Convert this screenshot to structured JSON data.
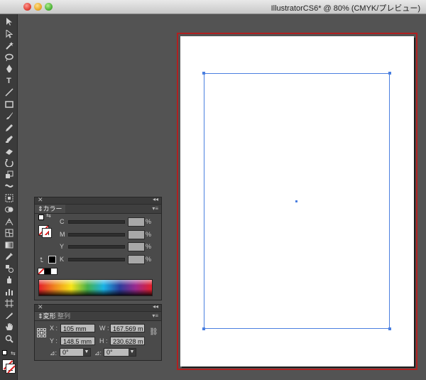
{
  "window": {
    "title": "IllustratorCS6* @ 80% (CMYK/プレビュー)"
  },
  "colors": {
    "accent_selection": "#4a7fe0",
    "artboard_border": "#b02020",
    "canvas_bg": "#535353"
  },
  "toolbar": {
    "tools": [
      {
        "name": "selection-tool-icon"
      },
      {
        "name": "direct-selection-tool-icon"
      },
      {
        "name": "magic-wand-tool-icon"
      },
      {
        "name": "lasso-tool-icon"
      },
      {
        "name": "pen-tool-icon"
      },
      {
        "name": "type-tool-icon",
        "glyph": "T"
      },
      {
        "name": "line-tool-icon"
      },
      {
        "name": "rectangle-tool-icon"
      },
      {
        "name": "paintbrush-tool-icon"
      },
      {
        "name": "pencil-tool-icon"
      },
      {
        "name": "blob-brush-tool-icon"
      },
      {
        "name": "eraser-tool-icon"
      },
      {
        "name": "rotate-tool-icon"
      },
      {
        "name": "scale-tool-icon"
      },
      {
        "name": "warp-tool-icon"
      },
      {
        "name": "free-transform-tool-icon"
      },
      {
        "name": "shape-builder-tool-icon"
      },
      {
        "name": "perspective-grid-tool-icon"
      },
      {
        "name": "mesh-tool-icon"
      },
      {
        "name": "gradient-tool-icon"
      },
      {
        "name": "eyedropper-tool-icon"
      },
      {
        "name": "blend-tool-icon"
      },
      {
        "name": "symbol-sprayer-tool-icon"
      },
      {
        "name": "column-graph-tool-icon"
      },
      {
        "name": "artboard-tool-icon"
      },
      {
        "name": "slice-tool-icon"
      },
      {
        "name": "hand-tool-icon"
      },
      {
        "name": "zoom-tool-icon"
      }
    ]
  },
  "color_panel": {
    "tab_label": "カラー",
    "channels": [
      {
        "label": "C",
        "unit": "%"
      },
      {
        "label": "M",
        "unit": "%"
      },
      {
        "label": "Y",
        "unit": "%"
      },
      {
        "label": "K",
        "unit": "%"
      }
    ]
  },
  "transform_panel": {
    "tabs": [
      "変形",
      "整列"
    ],
    "x_label": "X :",
    "x_value": "105 mm",
    "y_label": "Y :",
    "y_value": "148.5 mm",
    "w_label": "W :",
    "w_value": "167.569 m",
    "h_label": "H :",
    "h_value": "230.628 m",
    "rotate_label": "⊿:",
    "rotate_value": "0°",
    "shear_label": "⊿:",
    "shear_value": "0°"
  }
}
